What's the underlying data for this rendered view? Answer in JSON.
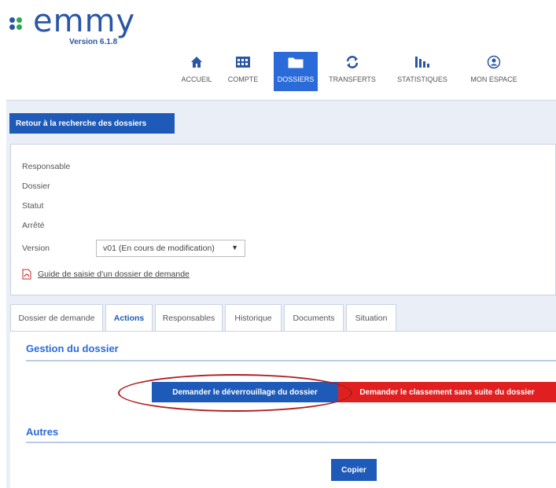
{
  "logo": {
    "text": "emmy",
    "version": "Version 6.1.8",
    "dot_colors": [
      "#2a56a6",
      "#2fa84f",
      "#2a56a6",
      "#2fa84f"
    ]
  },
  "nav": {
    "items": [
      {
        "label": "ACCUEIL",
        "icon": "home-icon",
        "active": false
      },
      {
        "label": "COMPTE",
        "icon": "account-icon",
        "active": false
      },
      {
        "label": "DOSSIERS",
        "icon": "folder-icon",
        "active": true
      },
      {
        "label": "TRANSFERTS",
        "icon": "transfer-icon",
        "active": false
      },
      {
        "label": "STATISTIQUES",
        "icon": "stats-icon",
        "active": false
      },
      {
        "label": "MON ESPACE",
        "icon": "user-icon",
        "active": false
      }
    ]
  },
  "back_button": "Retour à la recherche des dossiers",
  "info": {
    "responsable": "Responsable",
    "dossier": "Dossier",
    "statut": "Statut",
    "arrete": "Arrêté",
    "version_label": "Version",
    "version_value": "v01 (En cours de modification)",
    "guide_link": "Guide de saisie d'un dossier de demande"
  },
  "tabs": [
    {
      "label": "Dossier de demande",
      "active": false
    },
    {
      "label": "Actions",
      "active": true
    },
    {
      "label": "Responsables",
      "active": false
    },
    {
      "label": "Historique",
      "active": false
    },
    {
      "label": "Documents",
      "active": false
    },
    {
      "label": "Situation",
      "active": false
    }
  ],
  "gestion": {
    "title": "Gestion du dossier",
    "unlock_button": "Demander le déverrouillage du dossier",
    "close_button": "Demander le classement sans suite du dossier"
  },
  "autres": {
    "title": "Autres",
    "copy_button": "Copier"
  },
  "colors": {
    "accent": "#1e5bb8",
    "danger": "#e02020",
    "highlight": "#b01c1c",
    "panel_bg": "#e9eef7"
  }
}
